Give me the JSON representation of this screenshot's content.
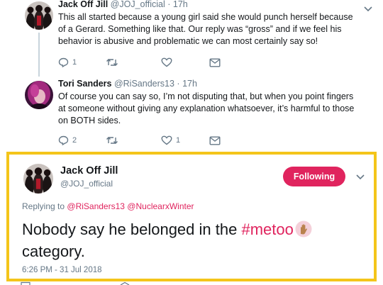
{
  "colors": {
    "accent": "#e0245e",
    "highlight_border": "#f4c51a",
    "muted": "#657786"
  },
  "tweets": [
    {
      "author_name": "Jack Off Jill",
      "author_handle": "@JOJ_official",
      "separator": "·",
      "time": "17h",
      "text": "This all started because a young girl said she would punch herself because of a Gerard. Something like that. Our reply was “gross” and if we feel his behavior is abusive and problematic we can most certainly say so!",
      "reply_count": "1",
      "retweet_count": "",
      "like_count": ""
    },
    {
      "author_name": "Tori Sanders",
      "author_handle": "@RiSanders13",
      "separator": "·",
      "time": "17h",
      "text": "Of course you can say so, I’m not disputing that, but when you point fingers at someone without giving any explanation whatsoever, it’s harmful to those on BOTH sides.",
      "reply_count": "2",
      "retweet_count": "",
      "like_count": "1"
    }
  ],
  "focused": {
    "author_name": "Jack Off Jill",
    "author_handle": "@JOJ_official",
    "follow_label": "Following",
    "replying_prefix": "Replying to",
    "mention_1": "@RiSanders13",
    "mention_2": "@NuclearxWinter",
    "text_before": "Nobody say he belonged in the ",
    "hashtag": "#metoo",
    "text_after": "category.",
    "timestamp": "6:26 PM - 31 Jul 2018"
  }
}
